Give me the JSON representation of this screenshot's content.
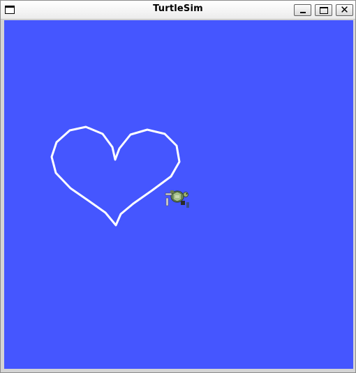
{
  "window": {
    "title": "TurtleSim",
    "buttons": {
      "minimize": "minimize-icon",
      "maximize": "maximize-icon",
      "close": "close-icon"
    }
  },
  "canvas": {
    "background_color": "#4556ff",
    "pen_color": "#ffffff"
  },
  "turtle": {
    "icon": "turtle-icon"
  }
}
